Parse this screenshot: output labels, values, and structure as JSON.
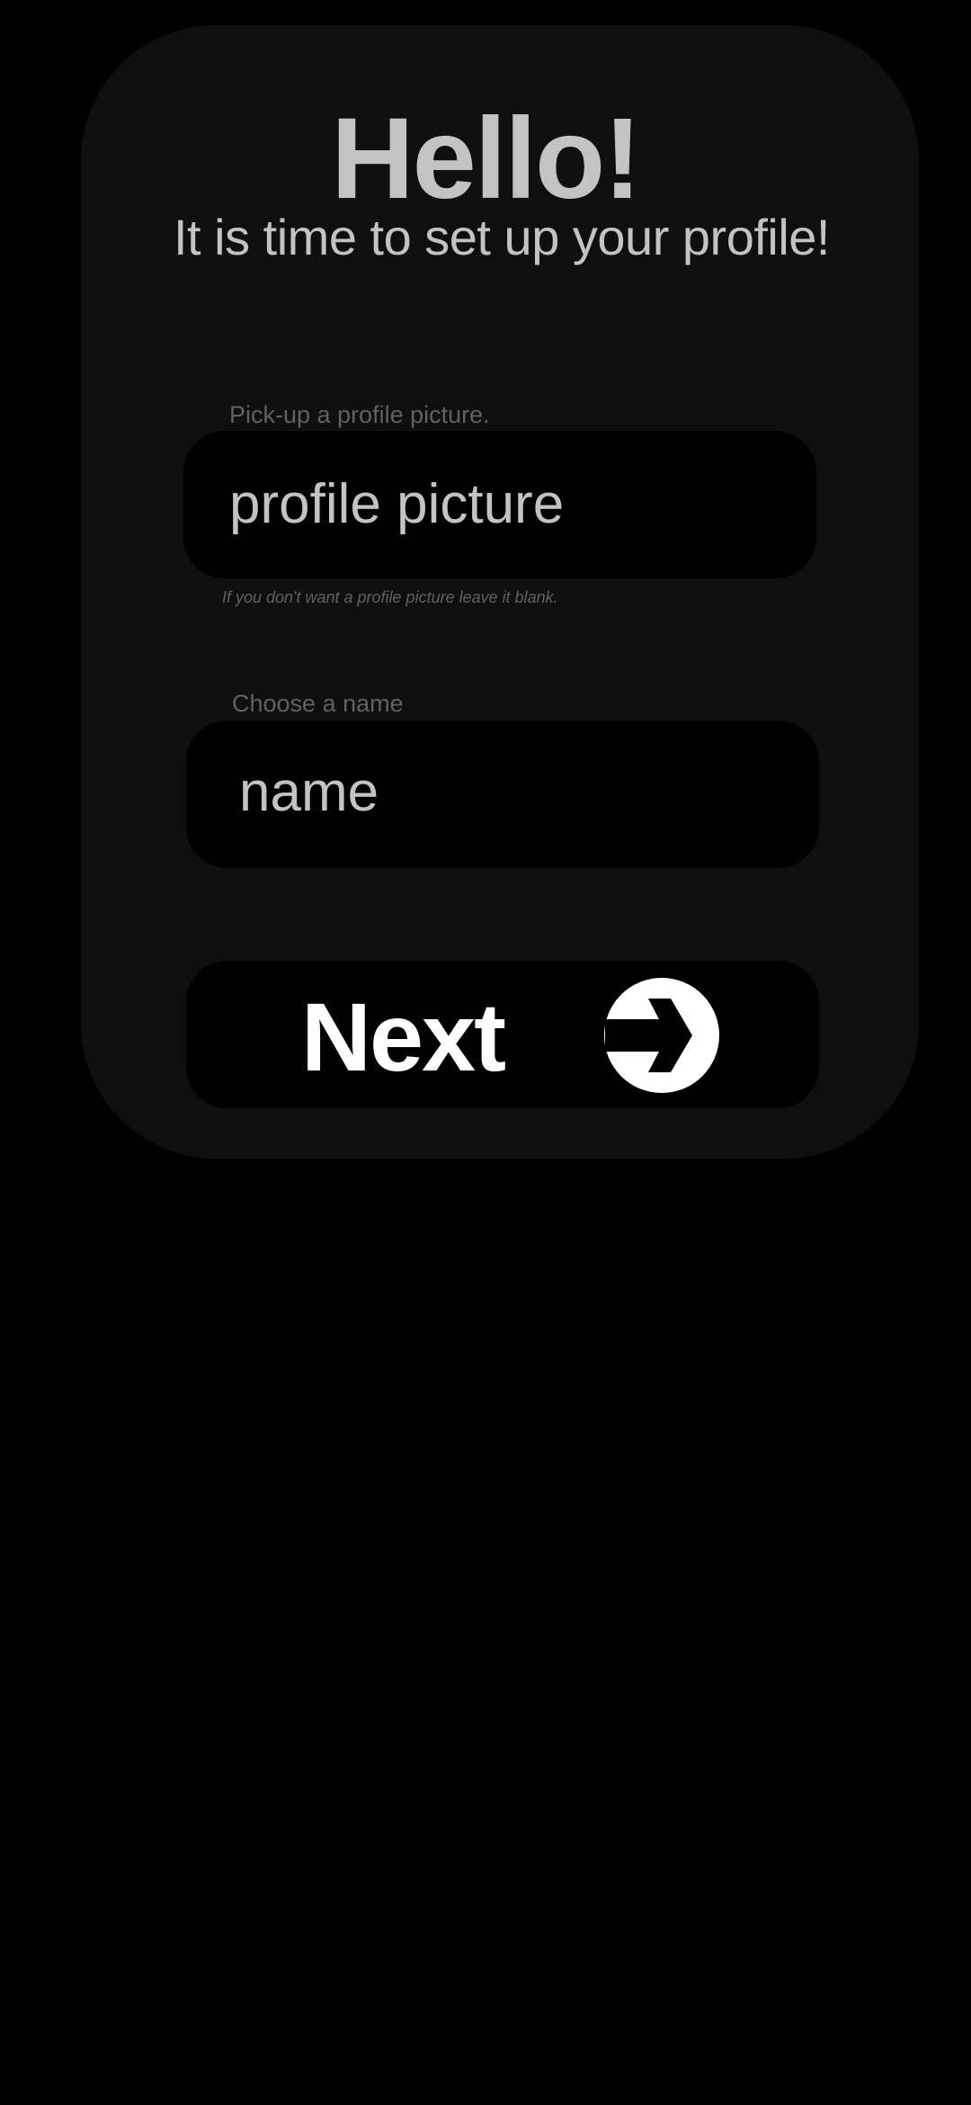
{
  "header": {
    "title": "Hello!",
    "subtitle": "It is time to set up your profile!"
  },
  "profile_picture": {
    "label": "Pick-up a profile picture.",
    "placeholder": "profile picture",
    "hint": "If you don't want a profile picture leave it blank."
  },
  "name": {
    "label": "Choose a name",
    "placeholder": "name"
  },
  "next_button": {
    "label": "Next",
    "icon": "arrow-right-circle-icon"
  },
  "colors": {
    "background": "#000000",
    "card": "#0f0f0f",
    "text": "#c3c3c3",
    "muted_text": "#616161",
    "button_text": "#ffffff"
  }
}
